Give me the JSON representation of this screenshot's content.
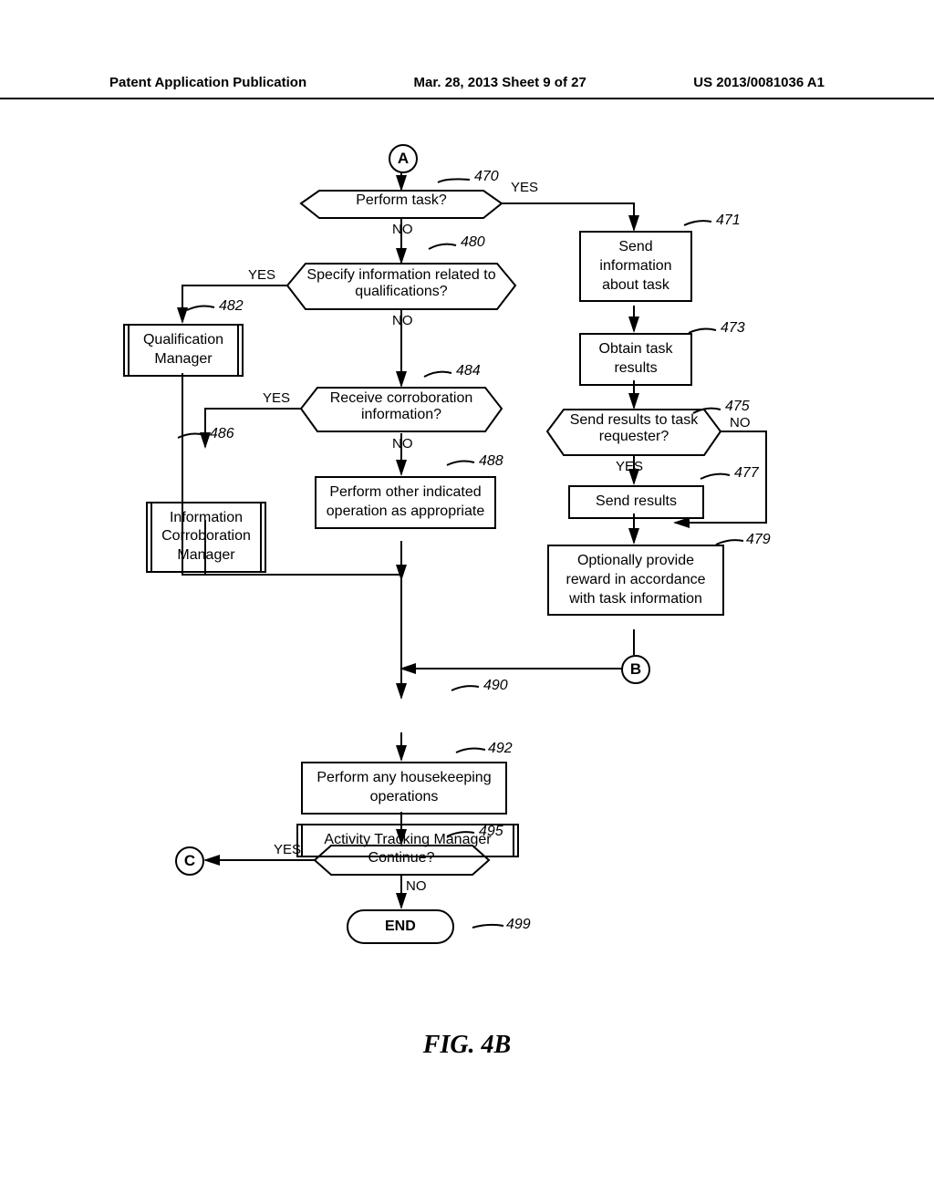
{
  "header": {
    "left": "Patent Application Publication",
    "center": "Mar. 28, 2013  Sheet 9 of 27",
    "right": "US 2013/0081036 A1"
  },
  "figure_caption": "FIG. 4B",
  "nodes": {
    "A": "A",
    "B": "B",
    "C": "C",
    "n470": "Perform task?",
    "n471": "Send information about task",
    "n473": "Obtain task results",
    "n475": "Send results to task requester?",
    "n477": "Send results",
    "n479": "Optionally provide reward in accordance with task information",
    "n480": "Specify information related to qualifications?",
    "n482": "Qualification Manager",
    "n484": "Receive corroboration information?",
    "n486": "Information Corroboration Manager",
    "n488": "Perform other indicated operation as appropriate",
    "n490": "Activity Tracking Manager",
    "n492": "Perform any housekeeping operations",
    "n495": "Continue?",
    "n499": "END"
  },
  "labels": {
    "yes": "YES",
    "no": "NO"
  },
  "refs": {
    "r470": "470",
    "r471": "471",
    "r473": "473",
    "r475": "475",
    "r477": "477",
    "r479": "479",
    "r480": "480",
    "r482": "482",
    "r484": "484",
    "r486": "486",
    "r488": "488",
    "r490": "490",
    "r492": "492",
    "r495": "495",
    "r499": "499"
  }
}
